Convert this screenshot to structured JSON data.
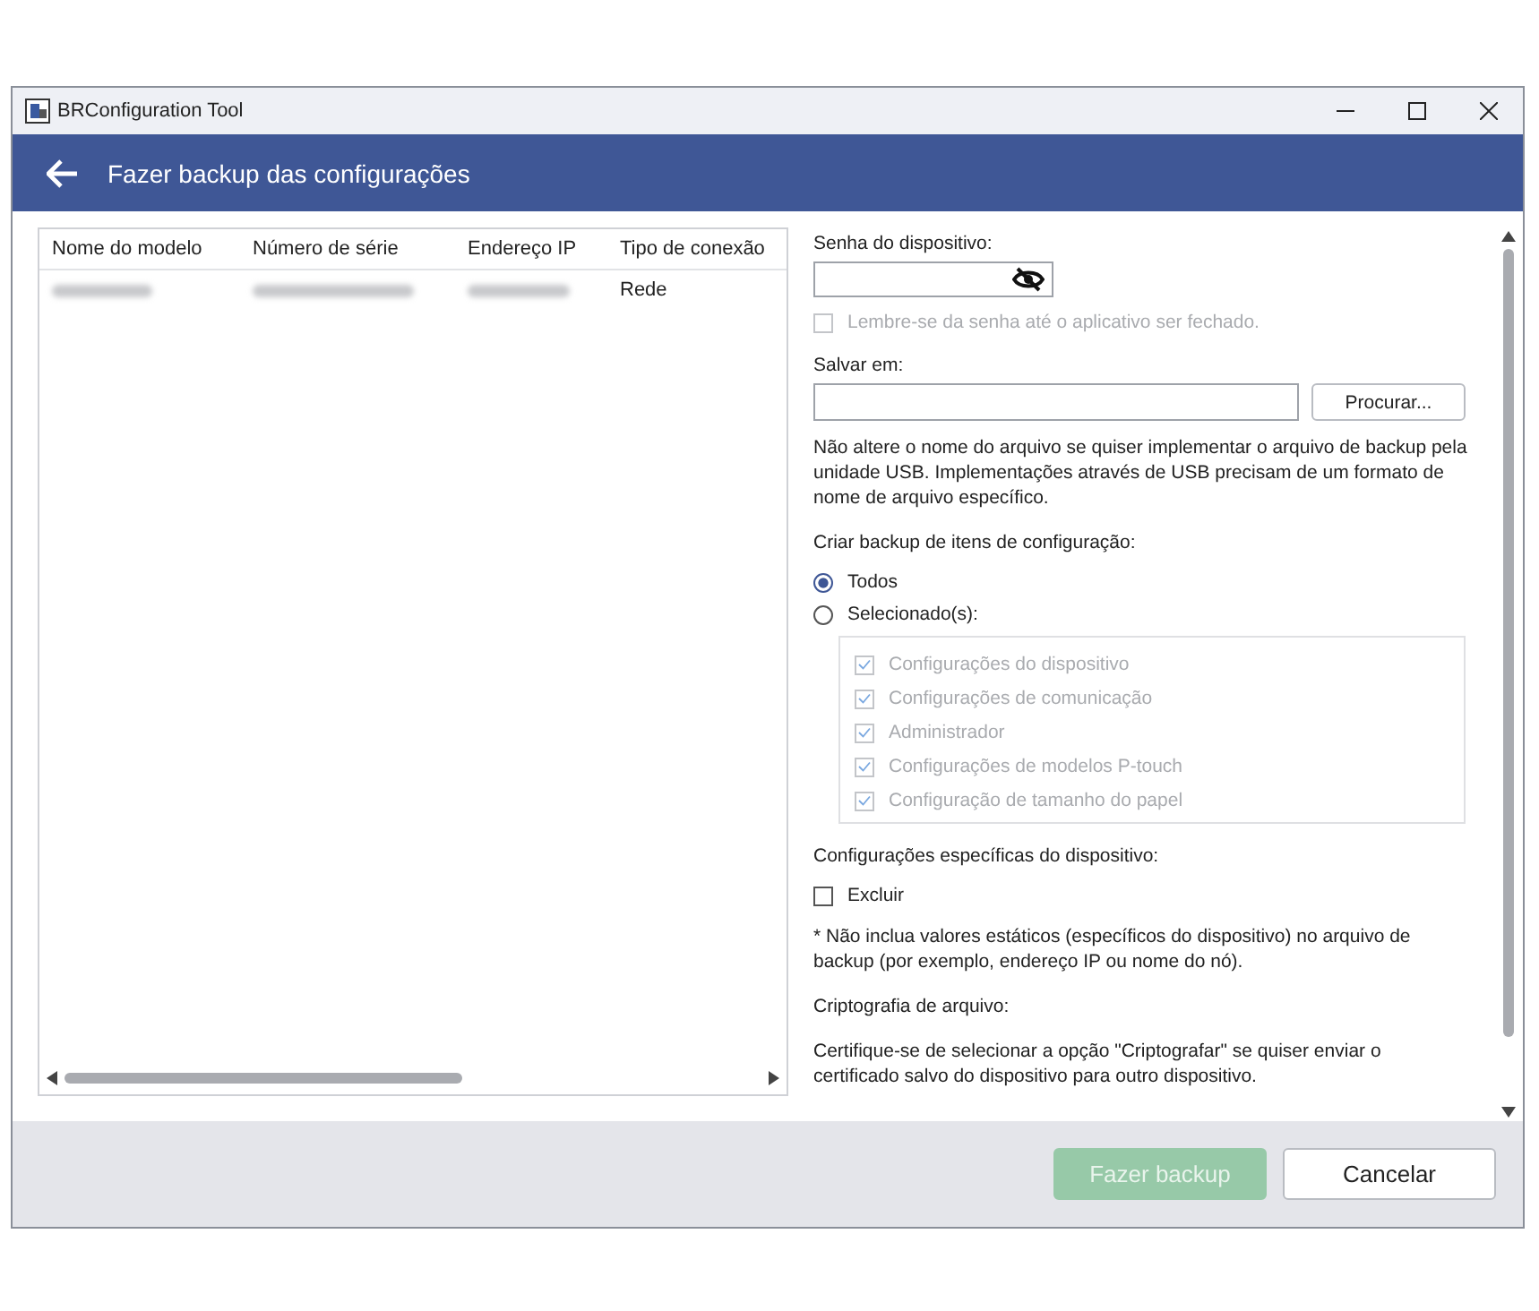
{
  "window": {
    "title": "BRConfiguration Tool"
  },
  "header": {
    "title": "Fazer backup das configurações"
  },
  "table": {
    "columns": [
      "Nome do modelo",
      "Número de série",
      "Endereço IP",
      "Tipo de conexão"
    ],
    "rows": [
      {
        "selected": false,
        "cells": [
          null,
          null,
          null,
          "Rede"
        ]
      }
    ]
  },
  "form": {
    "password": {
      "label": "Senha do dispositivo:",
      "remember": {
        "label": "Lembre-se da senha até o aplicativo ser fechado.",
        "checked": false,
        "disabled": true
      }
    },
    "save": {
      "label": "Salvar em:",
      "browse": "Procurar...",
      "note": "Não altere o nome do arquivo se quiser implementar o arquivo de backup pela unidade USB. Implementações através de USB precisam de um formato de nome de arquivo específico."
    },
    "items": {
      "label": "Criar backup de itens de configuração:",
      "options": [
        {
          "label": "Todos",
          "selected": true
        },
        {
          "label": "Selecionado(s):",
          "selected": false
        }
      ],
      "checks": [
        {
          "label": "Configurações do dispositivo",
          "checked": true,
          "disabled": true
        },
        {
          "label": "Configurações de comunicação",
          "checked": true,
          "disabled": true
        },
        {
          "label": "Administrador",
          "checked": true,
          "disabled": true
        },
        {
          "label": "Configurações de modelos P-touch",
          "checked": true,
          "disabled": true
        },
        {
          "label": "Configuração de tamanho do papel",
          "checked": true,
          "disabled": true
        }
      ]
    },
    "specific": {
      "label": "Configurações específicas do dispositivo:",
      "exclude": {
        "label": "Excluir",
        "checked": false
      },
      "note": "* Não inclua valores estáticos (específicos do dispositivo) no arquivo de backup (por exemplo, endereço IP ou nome do nó)."
    },
    "encryption": {
      "label": "Criptografia de arquivo:",
      "note": "Certifique-se de selecionar a opção \"Criptografar\" se quiser enviar o certificado salvo do dispositivo para outro dispositivo."
    }
  },
  "buttons": [
    {
      "label": "Fazer backup",
      "kind": "primary",
      "disabled": true
    },
    {
      "label": "Cancelar",
      "kind": "secondary",
      "disabled": false
    }
  ]
}
